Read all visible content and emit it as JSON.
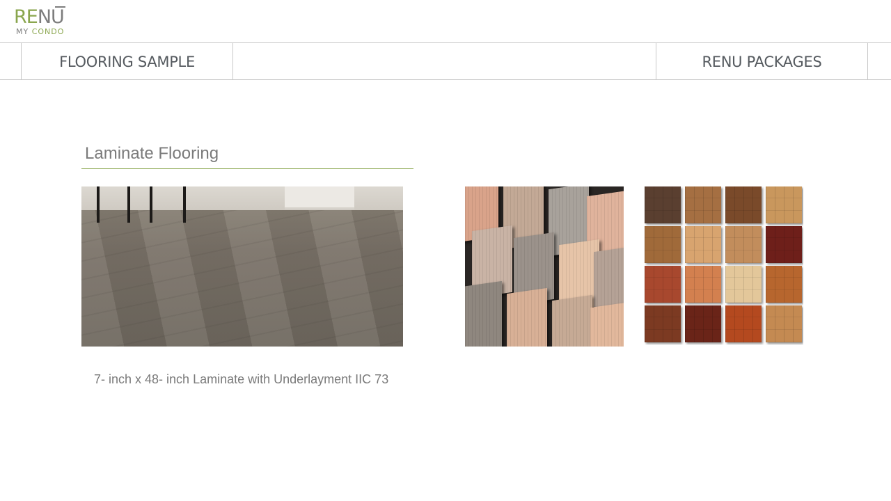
{
  "logo": {
    "brand_prefix": "RE",
    "brand_letter": "NU",
    "sub_prefix": "MY ",
    "sub_highlight": "CONDO"
  },
  "nav": {
    "tabs": [
      {
        "label": "FLOORING SAMPLE"
      },
      {
        "label": "RENU PACKAGES"
      }
    ]
  },
  "section": {
    "title": "Laminate Flooring",
    "caption": "7- inch x 48- inch Laminate with Underlayment IIC 73"
  },
  "colors": {
    "brand_green": "#8aa64e",
    "text_gray": "#7a7a7a",
    "nav_text": "#555a5f"
  },
  "swatches": [
    "#5a3f30",
    "#a56f42",
    "#7a4a2a",
    "#c9975d",
    "#a06a3a",
    "#d8a46f",
    "#c28d5c",
    "#6e1f1a",
    "#a8482e",
    "#d3804f",
    "#e3c79a",
    "#b7662e",
    "#7c3a22",
    "#6a2418",
    "#b4491f",
    "#c48a52"
  ],
  "planks": [
    "#d9a38a",
    "#c3a996",
    "#a8a29b",
    "#e0b39c",
    "#c9b3a5",
    "#9b928b",
    "#e6c4a8",
    "#b5a296",
    "#8f877f",
    "#d8b096",
    "#c6aa95",
    "#e2b89c"
  ]
}
